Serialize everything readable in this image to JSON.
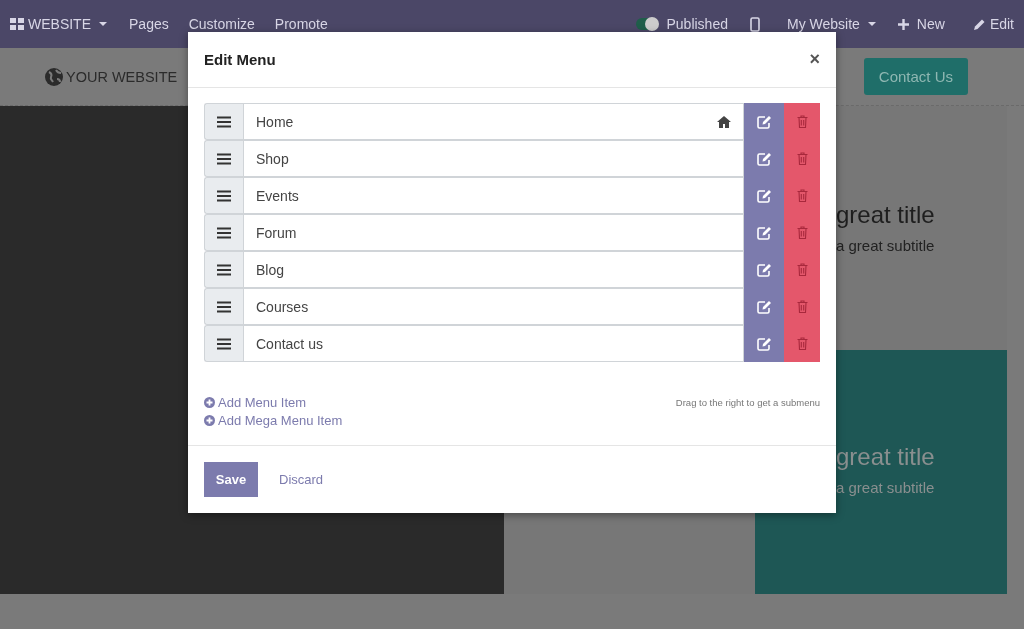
{
  "navbar": {
    "apps_menu": {
      "label": "WEBSITE"
    },
    "links": [
      "Pages",
      "Customize",
      "Promote"
    ],
    "publish": {
      "label": "Published",
      "on": true
    },
    "site_menu": {
      "label": "My Website"
    },
    "new_button": {
      "label": "New"
    },
    "edit_button": {
      "label": "Edit"
    }
  },
  "website": {
    "logo": "YOUR WEBSITE",
    "contact_button": "Contact Us",
    "banner_1": {
      "title": "great title",
      "subtitle": "a great subtitle"
    },
    "banner_2": {
      "title": "great title",
      "subtitle": "a great subtitle"
    }
  },
  "dialog": {
    "title": "Edit Menu",
    "close": "×",
    "menu_items": [
      {
        "label": "Home",
        "home": true
      },
      {
        "label": "Shop",
        "home": false
      },
      {
        "label": "Events",
        "home": false
      },
      {
        "label": "Forum",
        "home": false
      },
      {
        "label": "Blog",
        "home": false
      },
      {
        "label": "Courses",
        "home": false
      },
      {
        "label": "Contact us",
        "home": false
      }
    ],
    "add_links": [
      "Add Menu Item",
      "Add Mega Menu Item"
    ],
    "hint": "Drag to the right to get a submenu",
    "save": "Save",
    "discard": "Discard"
  }
}
